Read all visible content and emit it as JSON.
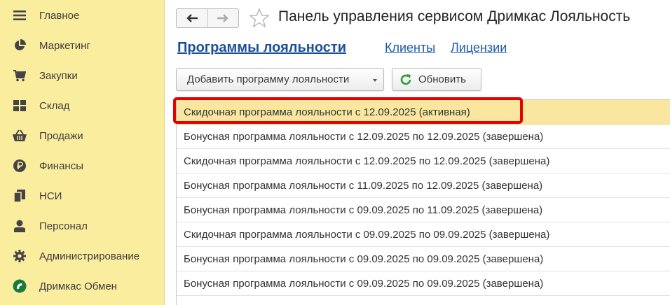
{
  "sidebar": {
    "items": [
      {
        "label": "Главное",
        "icon": "menu-lines-icon"
      },
      {
        "label": "Маркетинг",
        "icon": "pie-chart-icon"
      },
      {
        "label": "Закупки",
        "icon": "shopping-cart-icon"
      },
      {
        "label": "Склад",
        "icon": "grid-warehouse-icon"
      },
      {
        "label": "Продажи",
        "icon": "basket-icon"
      },
      {
        "label": "Финансы",
        "icon": "ruble-coin-icon"
      },
      {
        "label": "НСИ",
        "icon": "documents-icon"
      },
      {
        "label": "Персонал",
        "icon": "person-icon"
      },
      {
        "label": "Администрирование",
        "icon": "gear-icon"
      },
      {
        "label": "Дримкас Обмен",
        "icon": "dreamkas-logo-icon"
      }
    ]
  },
  "header": {
    "title": "Панель управления сервисом Дримкас Лояльность"
  },
  "tabs": [
    {
      "label": "Программы лояльности",
      "active": true
    },
    {
      "label": "Клиенты",
      "active": false
    },
    {
      "label": "Лицензии",
      "active": false
    }
  ],
  "toolbar": {
    "add_label": "Добавить программу лояльности",
    "refresh_label": "Обновить"
  },
  "programs": [
    "Скидочная программа лояльности с 12.09.2025 (активная)",
    "Бонусная программа лояльности с 12.09.2025 по 12.09.2025 (завершена)",
    "Скидочная программа лояльности с 12.09.2025 по 12.09.2025 (завершена)",
    "Бонусная программа лояльности с 11.09.2025 по 12.09.2025 (завершена)",
    "Бонусная программа лояльности с 09.09.2025 по 11.09.2025 (завершена)",
    "Скидочная программа лояльности с 09.09.2025 по 09.09.2025 (завершена)",
    "Бонусная программа лояльности с 09.09.2025 по 09.09.2025 (завершена)",
    "Бонусная программа лояльности с 09.09.2025 по 09.09.2025 (завершена)"
  ],
  "colors": {
    "sidebar_bg": "#fbed9e",
    "link": "#1c5ca8",
    "selected_row": "#f9e79f",
    "highlight_border": "#e60000",
    "refresh_icon": "#2e9b3a"
  }
}
